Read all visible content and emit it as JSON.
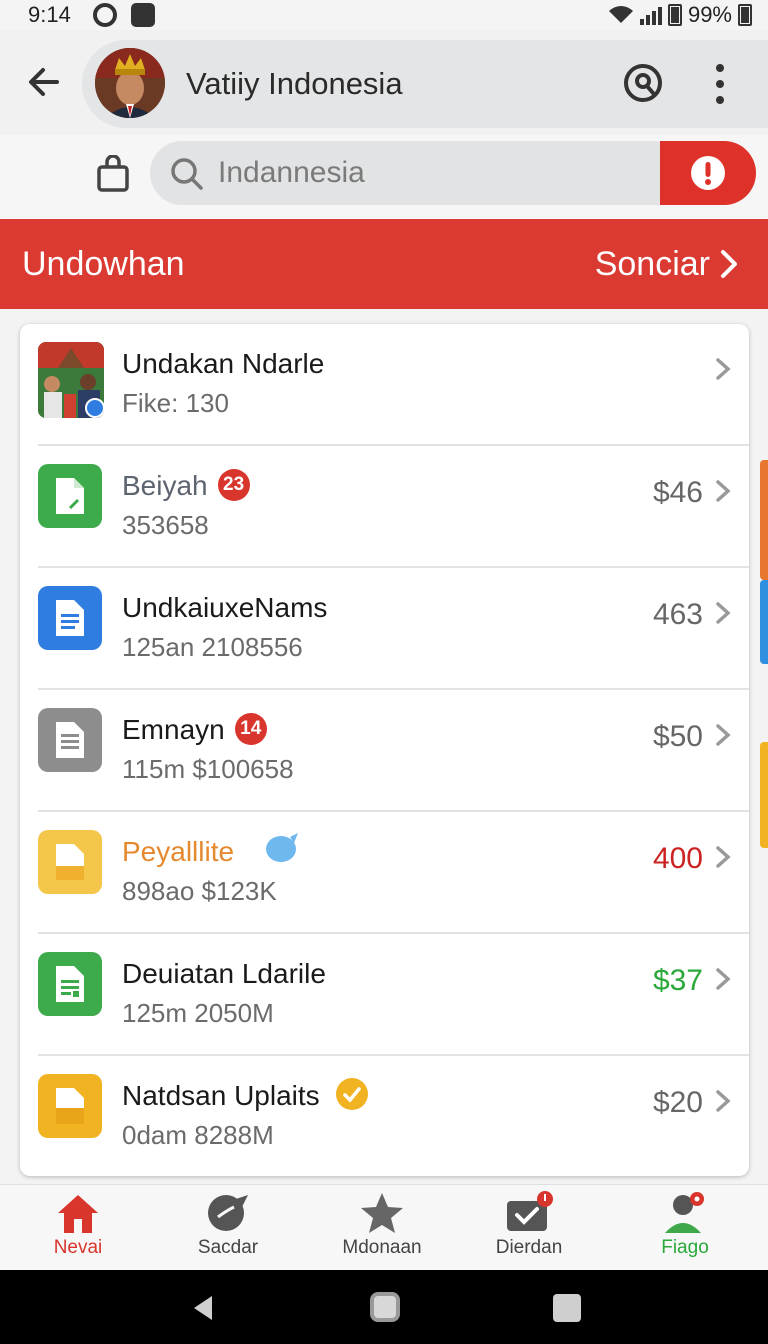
{
  "status_bar": {
    "time": "9:14",
    "battery": "99%"
  },
  "header": {
    "title": "Vatiiy Indonesia"
  },
  "search": {
    "placeholder": "Indannesia"
  },
  "banner": {
    "title": "Undowhan",
    "action": "Sonciar"
  },
  "list": [
    {
      "title": "Undakan Ndarle",
      "subtitle": "Fike: 130",
      "value": "",
      "badge": "",
      "icon": "profile-photo",
      "title_color": "#1a1a1a",
      "value_color": "#666666"
    },
    {
      "title": "Beiyah",
      "subtitle": "353658",
      "value": "$46",
      "badge": "23",
      "icon": "green-file-icon",
      "title_color": "#5d6470",
      "value_color": "#666666"
    },
    {
      "title": "UndkaiuxeNams",
      "subtitle": "125an 2108556",
      "value": "463",
      "badge": "",
      "icon": "blue-doc-icon",
      "title_color": "#1a1a1a",
      "value_color": "#666666"
    },
    {
      "title": "Emnayn",
      "subtitle": "115m $100658",
      "value": "$50",
      "badge": "14",
      "icon": "gray-doc-icon",
      "title_color": "#1a1a1a",
      "value_color": "#666666"
    },
    {
      "title": "Peyalllite",
      "subtitle": "898ao $123K",
      "value": "400",
      "badge": "",
      "icon": "yellow-file-icon",
      "title_color": "#e5892e",
      "value_color": "#cc2222"
    },
    {
      "title": "Deuiatan Ldarile",
      "subtitle": "125m 2050M",
      "value": "$37",
      "badge": "",
      "icon": "green-sheet-icon",
      "title_color": "#1a1a1a",
      "value_color": "#2aa83a"
    },
    {
      "title": "Natdsan Uplaits",
      "subtitle": "0dam 8288M",
      "value": "$20",
      "badge": "",
      "icon": "yellow-folder-icon",
      "title_color": "#1a1a1a",
      "value_color": "#666666"
    }
  ],
  "bottom_nav": [
    {
      "label": "Nevai",
      "icon": "home-icon",
      "color": "#d8352c"
    },
    {
      "label": "Sacdar",
      "icon": "chat-icon",
      "color": "#444444"
    },
    {
      "label": "Mdonaan",
      "icon": "star-icon",
      "color": "#444444"
    },
    {
      "label": "Dierdan",
      "icon": "check-message-icon",
      "color": "#444444"
    },
    {
      "label": "Fiago",
      "icon": "profile-icon",
      "color": "#2aa83a"
    }
  ],
  "colors": {
    "accent": "#db3a32",
    "brand_green": "#2aa83a",
    "brand_blue": "#2f7de1",
    "brand_yellow": "#f2b323"
  }
}
